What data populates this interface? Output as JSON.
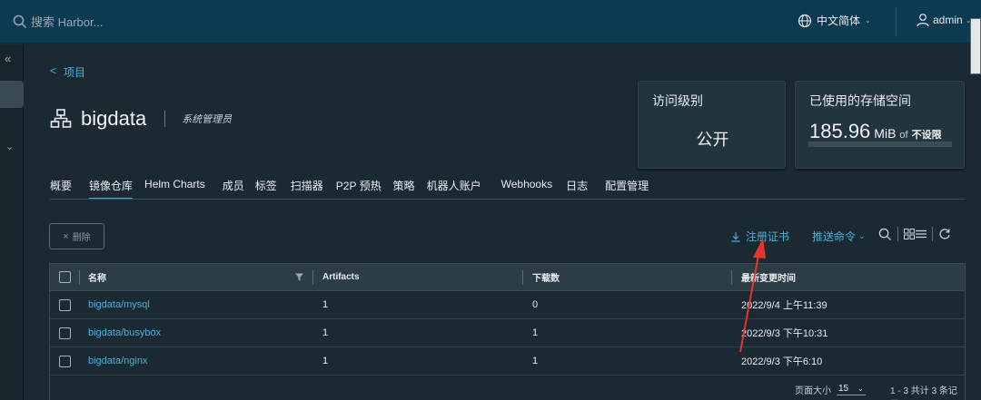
{
  "header": {
    "search_placeholder": "搜索 Harbor...",
    "language": "中文简体",
    "user": "admin"
  },
  "breadcrumb": {
    "back": "<",
    "label": "项目"
  },
  "project": {
    "name": "bigdata",
    "role": "系统管理员"
  },
  "cards": {
    "access": {
      "label": "访问级别",
      "value": "公开"
    },
    "storage": {
      "label": "已使用的存储空间",
      "value": "185.96",
      "unit": "MiB",
      "of": "of",
      "limit": "不设限",
      "used_fraction": 0
    }
  },
  "tabs": [
    {
      "label": "概要",
      "active": false
    },
    {
      "label": "镜像仓库",
      "active": true
    },
    {
      "label": "Helm Charts",
      "active": false
    },
    {
      "label": "成员",
      "active": false
    },
    {
      "label": "标签",
      "active": false
    },
    {
      "label": "扫描器",
      "active": false
    },
    {
      "label": "P2P 预热",
      "active": false
    },
    {
      "label": "策略",
      "active": false
    },
    {
      "label": "机器人账户",
      "active": false
    },
    {
      "label": "Webhooks",
      "active": false
    },
    {
      "label": "日志",
      "active": false
    },
    {
      "label": "配置管理",
      "active": false
    }
  ],
  "toolbar": {
    "delete_label": "删除",
    "register_cert_label": "注册证书",
    "push_cmd_label": "推送命令"
  },
  "table": {
    "columns": [
      "名称",
      "Artifacts",
      "下载数",
      "最新变更时间"
    ],
    "rows": [
      {
        "name": "bigdata/mysql",
        "artifacts": "1",
        "pulls": "0",
        "updated": "2022/9/4 上午11:39"
      },
      {
        "name": "bigdata/busybox",
        "artifacts": "1",
        "pulls": "1",
        "updated": "2022/9/3 下午10:31"
      },
      {
        "name": "bigdata/nginx",
        "artifacts": "1",
        "pulls": "1",
        "updated": "2022/9/3 下午6:10"
      }
    ],
    "footer": {
      "page_size_label": "页面大小",
      "page_size": "15",
      "count_text": "1 - 3 共计 3 条记录"
    }
  },
  "colors": {
    "accent": "#49afd9",
    "header_bg": "#0c3a50",
    "page_bg": "#1b2a32",
    "annotation": "#e8352b"
  }
}
